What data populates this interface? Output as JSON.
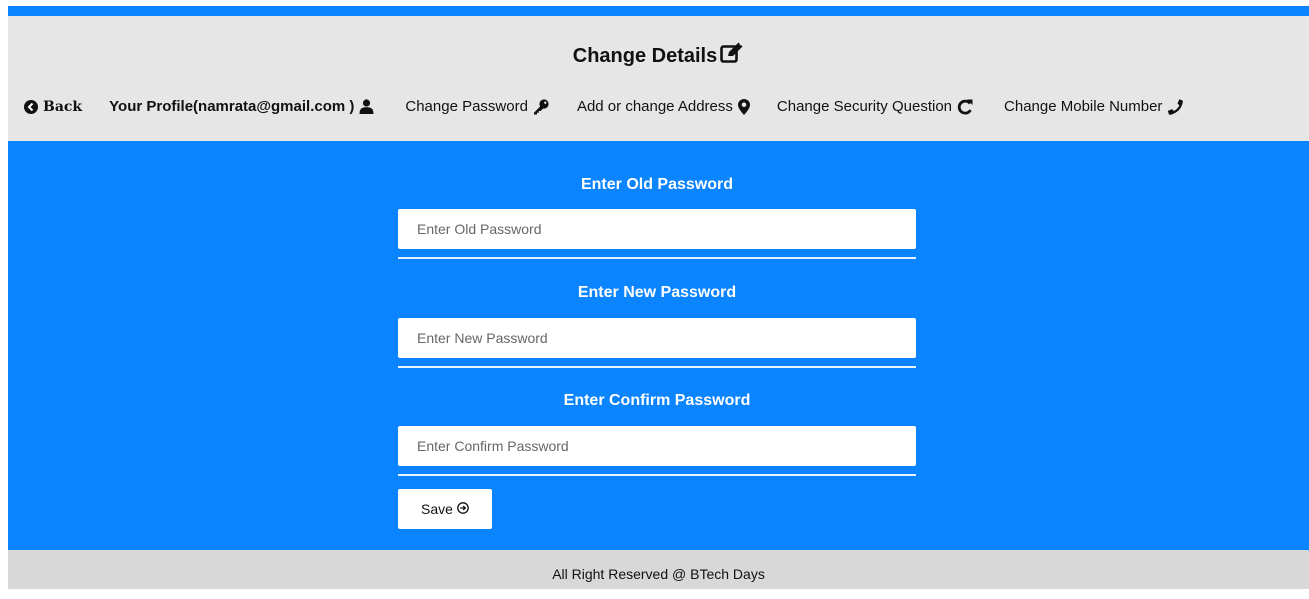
{
  "header": {
    "title": "Change Details",
    "title_icon": "edit-icon"
  },
  "nav": {
    "back_label": "Back",
    "profile_label": "Your Profile(namrata@gmail.com )",
    "change_password_label": "Change Password",
    "address_label": "Add or change Address",
    "security_label": "Change Security Question",
    "mobile_label": "Change Mobile Number"
  },
  "form": {
    "old_label": "Enter Old Password",
    "old_placeholder": "Enter Old Password",
    "new_label": "Enter New Password",
    "new_placeholder": "Enter New Password",
    "confirm_label": "Enter Confirm Password",
    "confirm_placeholder": "Enter Confirm Password",
    "save_label": "Save"
  },
  "footer": {
    "text": "All Right Reserved @ BTech Days"
  },
  "colors": {
    "accent": "#0a84ff",
    "header_bg": "#e6e6e6",
    "footer_bg": "#d8d8d8"
  }
}
